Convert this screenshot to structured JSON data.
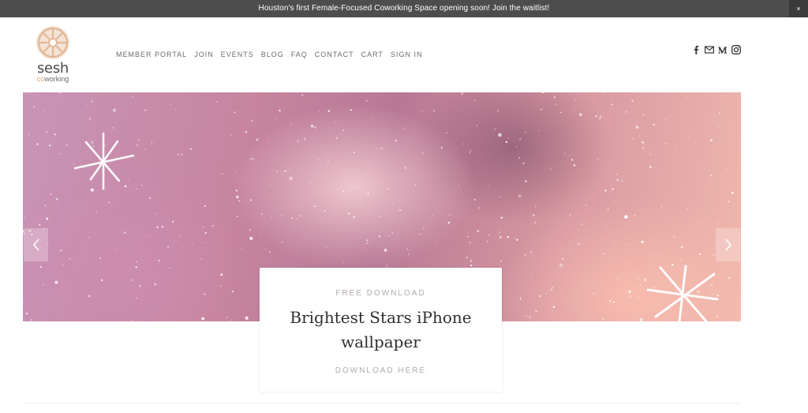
{
  "announcement": {
    "text": "Houston's first Female-Focused Coworking Space opening soon! Join the waitlist!",
    "close_label": "×"
  },
  "logo": {
    "word": "sesh",
    "sub_accent": "co",
    "sub_rest": "working",
    "mark_icon": "sunburst-logo-mark"
  },
  "nav": {
    "items": [
      "MEMBER PORTAL",
      "JOIN",
      "EVENTS",
      "BLOG",
      "FAQ",
      "CONTACT",
      "CART",
      "SIGN IN"
    ]
  },
  "social": {
    "icons": [
      "facebook-icon",
      "email-icon",
      "medium-icon",
      "instagram-icon"
    ]
  },
  "hero": {
    "kicker": "FREE DOWNLOAD",
    "title": "Brightest Stars iPhone wallpaper",
    "cta": "DOWNLOAD HERE",
    "prev_icon": "chevron-left-icon",
    "next_icon": "chevron-right-icon"
  },
  "colors": {
    "announcement_bg": "#4d4d4d",
    "logo_accent": "#d9a47f",
    "nav_text": "#6b6b6b",
    "card_text": "#2f2f2f"
  }
}
